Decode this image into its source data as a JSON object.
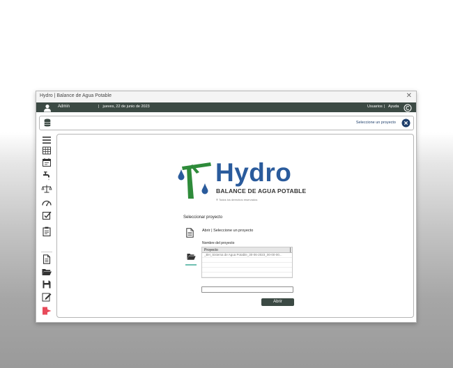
{
  "window": {
    "title": "Hydro | Balance de Agua Potable",
    "close_icon": "close-icon"
  },
  "topbar": {
    "user_name": "Admin",
    "date": "jueves, 22 de junio de 2023",
    "users_link": "Usuarios",
    "separator": "|",
    "help_link": "Ayuda",
    "background": "#3c4a44"
  },
  "project_bar": {
    "label": "Seleccione un proyecto",
    "button_color": "#1f3f6b"
  },
  "sidebar": {
    "icons": [
      "menu-icon",
      "table-icon",
      "calendar-icon",
      "faucet-icon",
      "balance-scale-icon",
      "gauge-icon",
      "checklist-icon",
      "clipboard-icon",
      "document-icon",
      "folder-open-icon",
      "save-icon",
      "edit-icon",
      "exit-icon"
    ]
  },
  "logo": {
    "main": "Hydro",
    "sub": "BALANCE DE AGUA POTABLE",
    "rights": "® Todos los derechos reservados",
    "main_color": "#2a5b9c",
    "pole_color": "#2e8b3a",
    "drop_color": "#2a5b9c"
  },
  "panel": {
    "heading": "Seleccionar proyecto",
    "title": "Abrir | Seleccione un proyecto",
    "name_label": "Nombre del proyecto",
    "table_header": "Proyecto",
    "rows": [
      "_BH_Sistema de Agua Potable_30-06-2023_00-00-00..."
    ],
    "name_input_value": "",
    "open_button": "Abrir",
    "accent": "#6fbfb1"
  }
}
